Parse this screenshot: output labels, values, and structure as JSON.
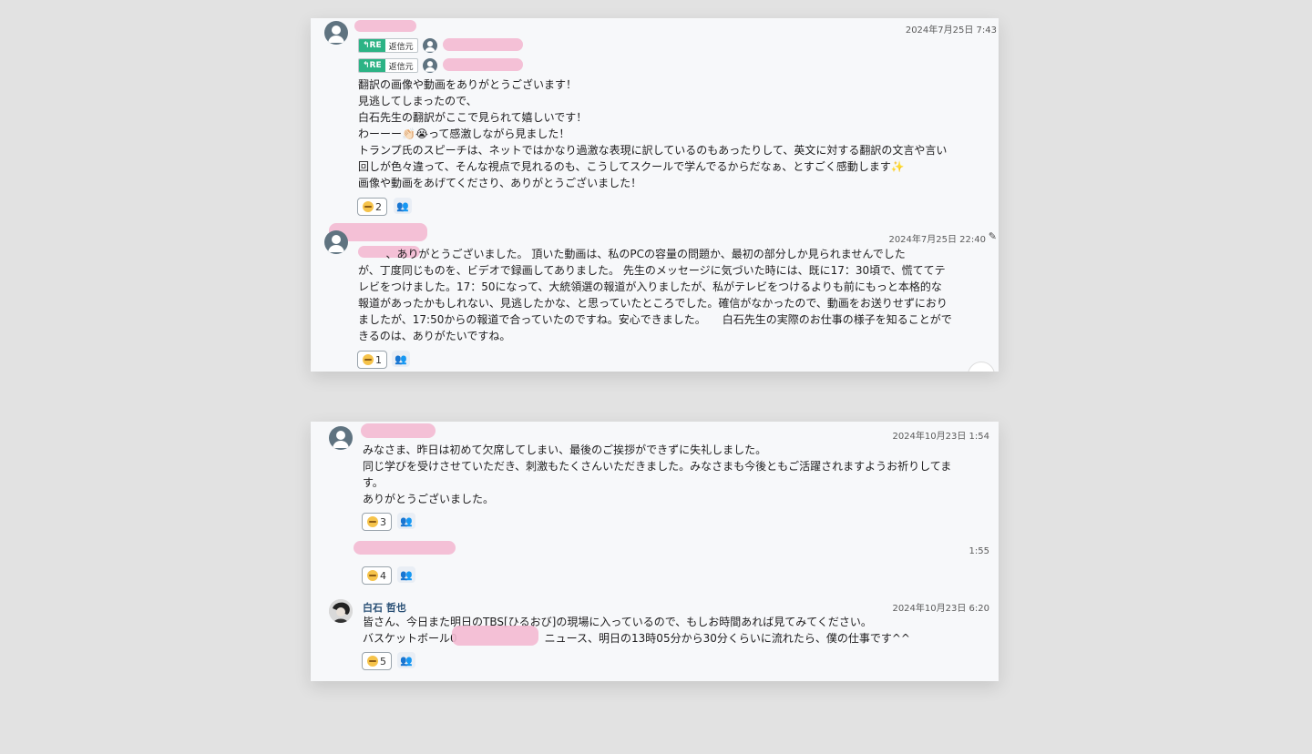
{
  "card1": {
    "msg1": {
      "timestamp": "2024年7月25日 7:43",
      "reply_refs": [
        {
          "tag": "RE",
          "label": "返信元"
        },
        {
          "tag": "RE",
          "label": "返信元"
        }
      ],
      "body": "翻訳の画像や動画をありがとうございます！\n見逃してしまったので、\n白石先生の翻訳がここで見られて嬉しいです！\nわーーー👏🏻😭って感激しながら見ました！\nトランプ氏のスピーチは、ネットではかなり過激な表現に訳しているのもあったりして、英文に対する翻訳の文言や言い\n回しが色々違って、そんな視点で見れるのも、こうしてスクールで学んでるからだなぁ、とすごく感動します✨\n画像や動画をあげてくださり、ありがとうございました！",
      "reaction_count": "2"
    },
    "msg2": {
      "timestamp": "2024年7月25日 22:40",
      "body": "        、ありがとうございました。 頂いた動画は、私のPCの容量の問題か、最初の部分しか見られませんでした\nが、丁度同じものを、ビデオで録画してありました。 先生のメッセージに気づいた時には、既に17：30頃で、慌ててテ\nレビをつけました。17：50になって、大統領選の報道が入りましたが、私がテレビをつけるよりも前にもっと本格的な\n報道があったかもしれない、見逃したかな、と思っていたところでした。確信がなかったので、動画をお送りせずにおり\nましたが、17:50からの報道で合っていたのですね。安心できました。　　白石先生の実際のお仕事の様子を知ることがで\nきるのは、ありがたいですね。",
      "reaction_count": "1"
    }
  },
  "card2": {
    "msg1": {
      "timestamp": "2024年10月23日 1:54",
      "body": "みなさま、昨日は初めて欠席してしまい、最後のご挨拶ができずに失礼しました。\n同じ学びを受けさせていただき、刺激もたくさんいただきました。みなさまも今後ともご活躍されますようお祈りしてま\nす。\nありがとうございました。",
      "reaction_count": "3"
    },
    "msg2": {
      "timestamp": "1:55",
      "reaction_count": "4"
    },
    "msg3": {
      "sender": "白石 哲也",
      "timestamp": "2024年10月23日 6:20",
      "body": "皆さん、今日また明日のTBS[ひるおび]の現場に入っているので、もしお時間あれば見てみてください。\nバスケットボール0　　　　　　　　ニュース、明日の13時05分から30分くらいに流れたら、僕の仕事です^^",
      "reaction_count": "5"
    }
  },
  "icons": {
    "avatar": "user-avatar-icon",
    "reply": "reply-arrow-icon",
    "reaction": "grimace-emoji-icon",
    "reactors": "user-list-icon",
    "edit": "pencil-icon"
  }
}
